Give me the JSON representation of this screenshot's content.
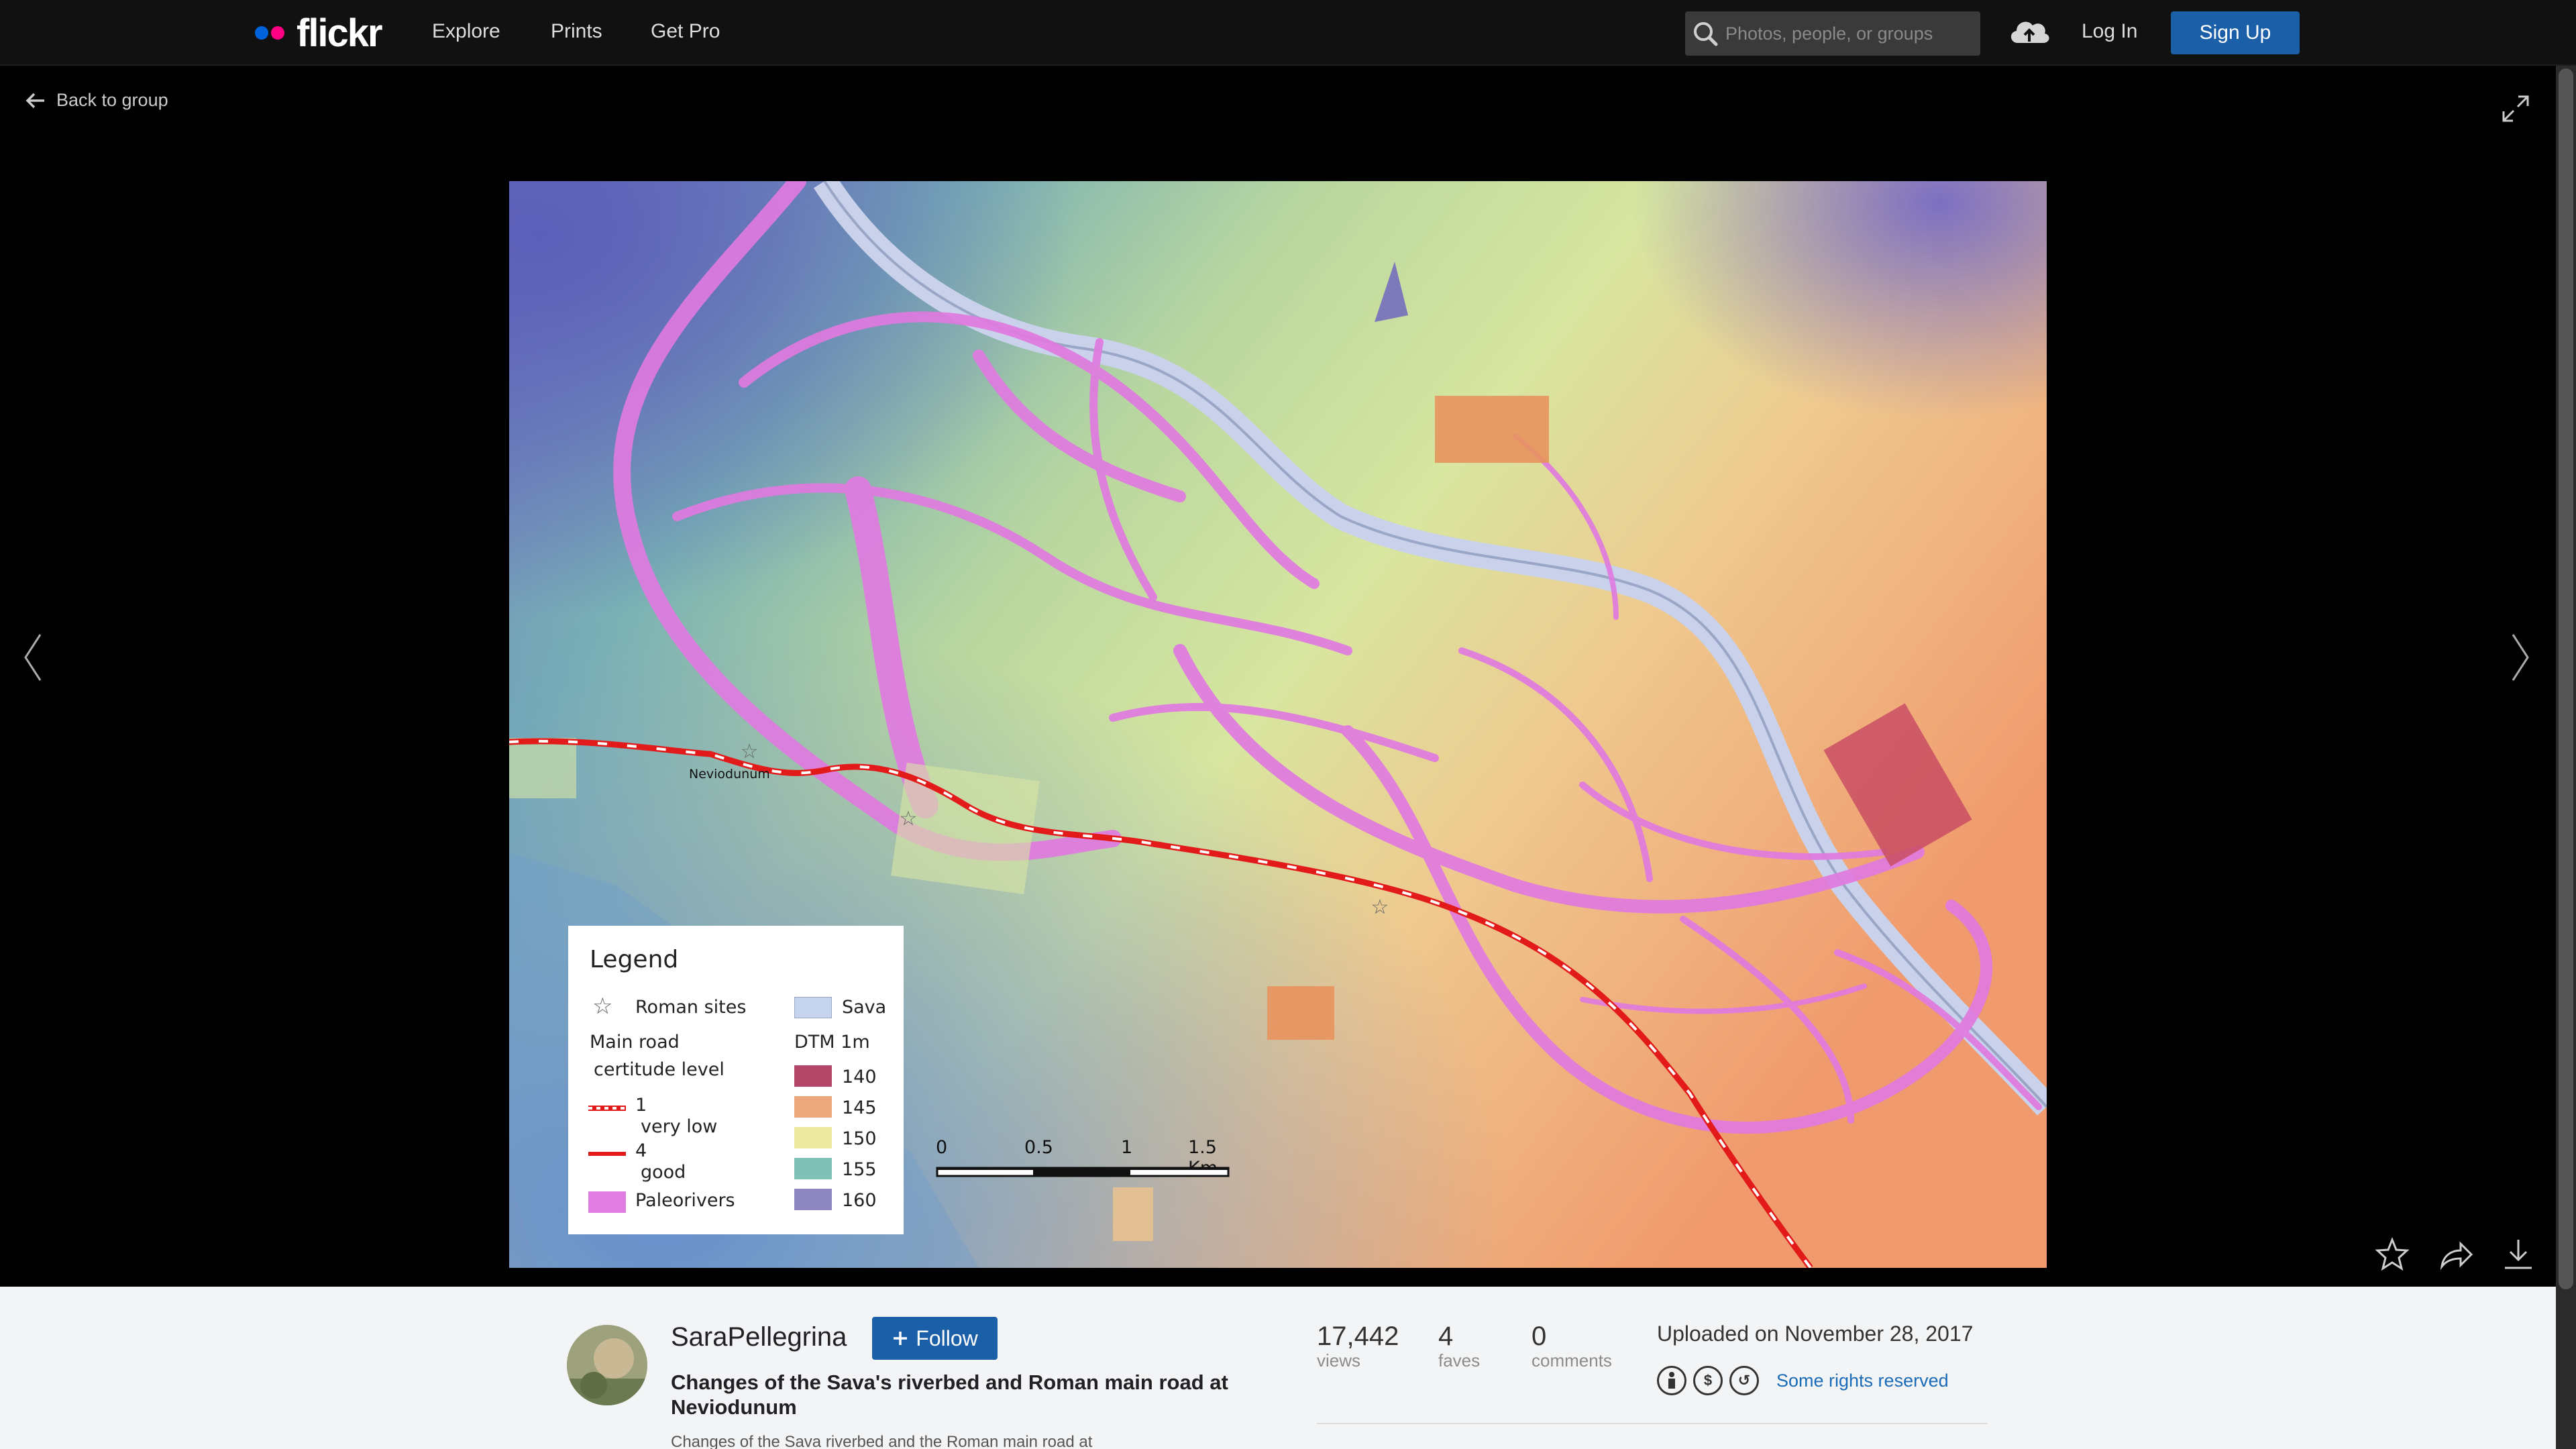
{
  "nav": {
    "logo": "flickr",
    "links": [
      "Explore",
      "Prints",
      "Get Pro"
    ],
    "search_placeholder": "Photos, people, or groups",
    "login": "Log In",
    "signup": "Sign Up"
  },
  "viewer": {
    "back_label": "Back to group"
  },
  "map": {
    "town_label": "Neviodunum",
    "legend": {
      "title": "Legend",
      "roman_sites": "Roman sites",
      "sava": "Sava",
      "main_road": "Main road",
      "certitude": "certitude level",
      "dtm": "DTM 1m",
      "level1": "1",
      "level1_desc": "very low",
      "level4": "4",
      "level4_desc": "good",
      "paleorivers": "Paleorivers",
      "dtm_values": [
        "140",
        "145",
        "150",
        "155",
        "160"
      ],
      "dtm_colors": [
        "#b2476a",
        "#eea87e",
        "#ecea9e",
        "#7fc1b4",
        "#8e86bf"
      ],
      "sava_color": "#c6d3ec",
      "paleo_color": "#e27ee2"
    },
    "scale": {
      "labels": [
        "0",
        "0.5",
        "1",
        "1.5 Km"
      ]
    }
  },
  "info": {
    "username": "SaraPellegrina",
    "follow": "Follow",
    "title": "Changes of the Sava's riverbed and Roman main road at Neviodunum",
    "description": "Changes of the Sava riverbed and the Roman main road at",
    "stats": [
      {
        "value": "17,442",
        "label": "views"
      },
      {
        "value": "4",
        "label": "faves"
      },
      {
        "value": "0",
        "label": "comments"
      }
    ],
    "uploaded": "Uploaded on November 28, 2017",
    "rights": "Some rights reserved"
  },
  "colors": {
    "accent": "#1a5fa8",
    "link": "#1a6bb8",
    "flickr_blue": "#0063dc",
    "flickr_pink": "#ff0084"
  }
}
